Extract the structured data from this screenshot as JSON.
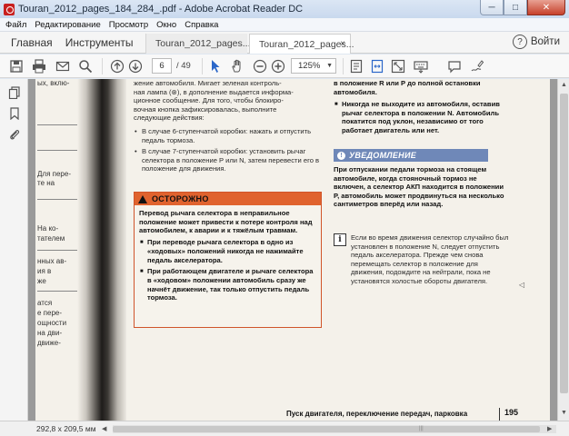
{
  "window": {
    "title": "Touran_2012_pages_184_284_.pdf - Adobe Acrobat Reader DC",
    "minimize": "─",
    "maximize": "□",
    "close": "✕"
  },
  "menu": {
    "items": [
      "Файл",
      "Редактирование",
      "Просмотр",
      "Окно",
      "Справка"
    ]
  },
  "tabs": {
    "home": "Главная",
    "tools": "Инструменты",
    "documents": [
      {
        "label": "Touran_2012_pages..."
      },
      {
        "label": "Touran_2012_pages..."
      }
    ],
    "close_glyph": "×",
    "help": "?",
    "signin": "Войти"
  },
  "toolbar": {
    "page_current": "6",
    "page_total": "/ 49",
    "zoom": "125%",
    "zoom_arrow": "▼"
  },
  "document": {
    "left_fragments": [
      "ых, вклю-",
      "Для пере-",
      "те на",
      "На ко-",
      "тателем",
      "нных ав-",
      "ия в",
      "же",
      "атся",
      "е пере-",
      "ощности",
      "на дви-",
      "движе-"
    ],
    "col2_top": [
      "жение автомобиля. Мигает зеленая контроль-",
      "ная лампа (⊛), в дополнение выдается информа-",
      "ционное сообщение. Для того, чтобы блокиро-",
      "вочная кнопка зафиксировалась, выполните",
      "следующие действия:"
    ],
    "col2_bullets": [
      "В случае 6-ступенчатой коробки: нажать и отпустить педаль тормоза.",
      "В случае 7-ступенчатой коробки: установить рычаг селектора в положение P или N, затем перевести его в положение для движения."
    ],
    "warning": {
      "title": "ОСТОРОЖНО",
      "intro": "Перевод рычага селектора в неправильное положение может привести к потере контроля над автомобилем, к аварии и к тяжёлым травмам.",
      "bullets": [
        "При переводе рычага селектора в одно из «ходовых» положений никогда не нажимайте педаль акселератора.",
        "При работающем двигателе и рычаге селектора в «ходовом» положении автомобиль сразу же начнёт движение, так только отпустить педаль тормоза."
      ]
    },
    "col3_top": [
      "в положение R или P до полной остановки",
      "автомобиля."
    ],
    "col3_bullet": "Никогда не выходите из автомобиля, оставив рычаг селектора в положении N. Автомобиль покатится под уклон, независимо от того работает двигатель или нет.",
    "notice": {
      "title": "УВЕДОМЛЕНИЕ",
      "icon": "!",
      "text": "При отпускании педали тормоза на стоящем автомобиле, когда стояночный тормоз не включен, а селектор АКП находится в положении P, автомобиль может продвинуться на несколько сантиметров вперёд или назад."
    },
    "info": {
      "icon": "i",
      "text": "Если во время движения селектор случайно был установлен в положение N, следует отпустить педаль акселератора. Прежде чем снова перемещать селектор в положение для движения, подождите на нейтрали, пока не установятся холостые обороты двигателя."
    },
    "footer_text": "Пуск двигателя, переключение передач, парковка",
    "page_number": "195"
  },
  "status": {
    "page_size": "292,8 x 209,5 мм"
  }
}
